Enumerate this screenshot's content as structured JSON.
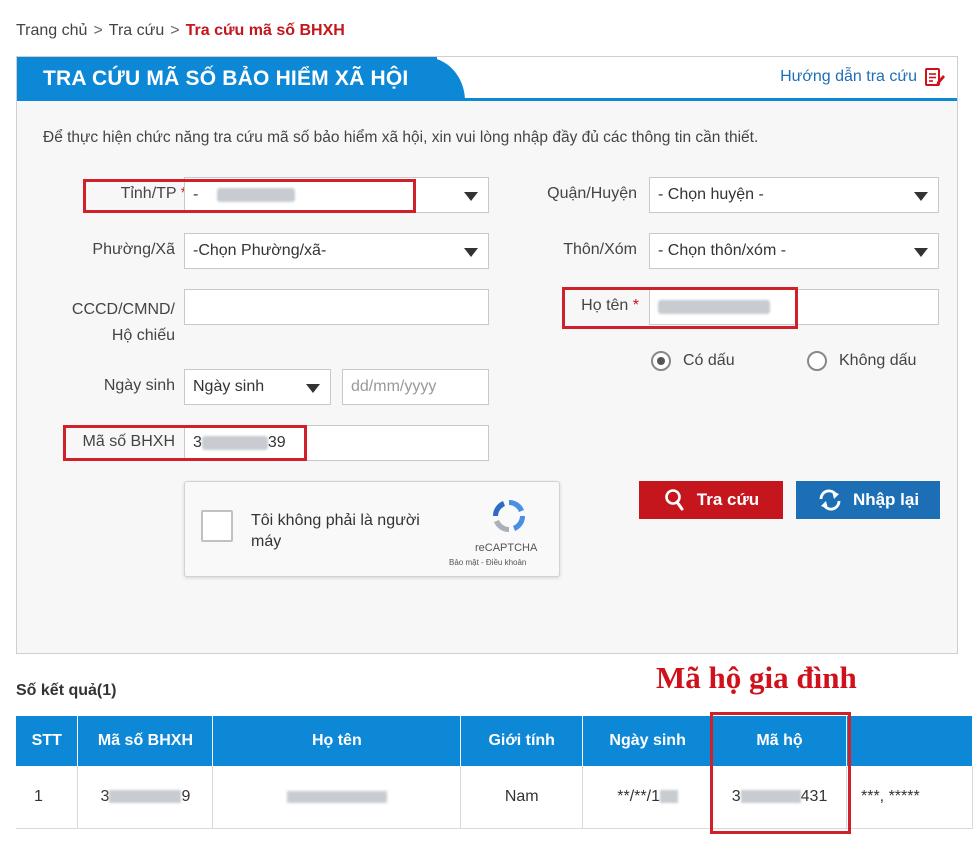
{
  "breadcrumb": {
    "home": "Trang chủ",
    "sep": ">",
    "lookup": "Tra cứu",
    "current": "Tra cứu mã số BHXH"
  },
  "panel": {
    "title": "TRA CỨU MÃ SỐ BẢO HIỂM XÃ HỘI",
    "guide": "Hướng dẫn tra cứu",
    "intro": "Để thực hiện chức năng tra cứu mã số bảo hiểm xã hội, xin vui lòng nhập đầy đủ các thông tin cần thiết."
  },
  "form": {
    "province_label": "Tỉnh/TP",
    "province_value": "-",
    "district_label": "Quận/Huyện",
    "district_value": "- Chọn huyện -",
    "ward_label": "Phường/Xã",
    "ward_value": "-Chọn Phường/xã-",
    "hamlet_label": "Thôn/Xóm",
    "hamlet_value": "- Chọn thôn/xóm -",
    "id_label_1": "CCCD/CMND/",
    "id_label_2": "Hộ chiếu",
    "name_label": "Họ tên",
    "required_mark": "*",
    "radio_accent": "Có dấu",
    "radio_no_accent": "Không dấu",
    "dob_label": "Ngày sinh",
    "dob_select": "Ngày sinh",
    "dob_placeholder": "dd/mm/yyyy",
    "bhxh_label": "Mã số BHXH",
    "bhxh_prefix": "3",
    "bhxh_suffix": "39"
  },
  "captcha": {
    "text": "Tôi không phải là người máy",
    "brand": "reCAPTCHA",
    "terms": "Bảo mật - Điều khoản"
  },
  "buttons": {
    "search": "Tra cứu",
    "reset": "Nhập lại"
  },
  "results": {
    "count_label": "Số kết quả(1)",
    "annotation": "Mã hộ gia đình",
    "headers": [
      "STT",
      "Mã số BHXH",
      "Họ tên",
      "Giới tính",
      "Ngày sinh",
      "Mã hộ",
      ""
    ],
    "row": {
      "stt": "1",
      "bhxh_prefix": "3",
      "bhxh_suffix": "9",
      "gender": "Nam",
      "dob_prefix": "**/**/1",
      "household_prefix": "3",
      "household_suffix": "431",
      "extra": "***, *****"
    }
  },
  "colors": {
    "brand_blue": "#0d88d7",
    "search_red": "#c4161c",
    "reset_blue": "#1c6fb5",
    "highlight_red": "#d0202a"
  }
}
